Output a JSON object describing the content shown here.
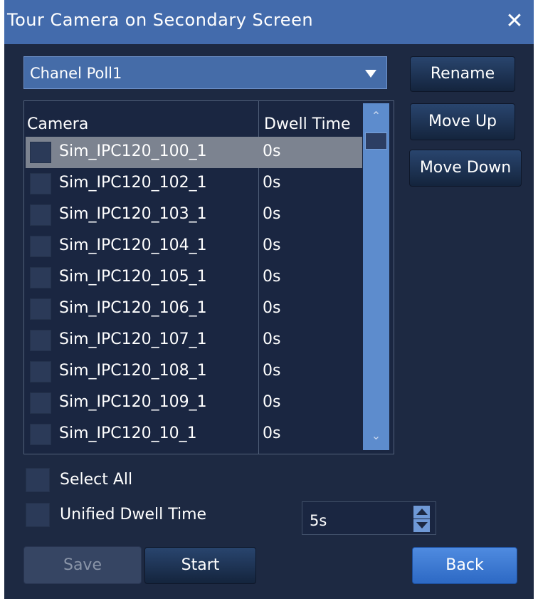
{
  "window": {
    "title": "Tour Camera on Secondary Screen",
    "close_glyph": "✕"
  },
  "poll_select": {
    "value": "Chanel Poll1"
  },
  "side_buttons": {
    "rename": "Rename",
    "move_up": "Move Up",
    "move_down": "Move Down"
  },
  "table": {
    "headers": [
      "Camera",
      "Dwell Time"
    ],
    "rows": [
      {
        "camera": "Sim_IPC120_100_1",
        "dwell": "0s",
        "selected": true
      },
      {
        "camera": "Sim_IPC120_102_1",
        "dwell": "0s",
        "selected": false
      },
      {
        "camera": "Sim_IPC120_103_1",
        "dwell": "0s",
        "selected": false
      },
      {
        "camera": "Sim_IPC120_104_1",
        "dwell": "0s",
        "selected": false
      },
      {
        "camera": "Sim_IPC120_105_1",
        "dwell": "0s",
        "selected": false
      },
      {
        "camera": "Sim_IPC120_106_1",
        "dwell": "0s",
        "selected": false
      },
      {
        "camera": "Sim_IPC120_107_1",
        "dwell": "0s",
        "selected": false
      },
      {
        "camera": "Sim_IPC120_108_1",
        "dwell": "0s",
        "selected": false
      },
      {
        "camera": "Sim_IPC120_109_1",
        "dwell": "0s",
        "selected": false
      },
      {
        "camera": "Sim_IPC120_10_1",
        "dwell": "0s",
        "selected": false
      }
    ]
  },
  "options": {
    "select_all_label": "Select All",
    "unified_dwell_label": "Unified Dwell Time",
    "unified_dwell_value": "5s"
  },
  "footer": {
    "save": "Save",
    "start": "Start",
    "back": "Back"
  },
  "colors": {
    "titlebar": "#436bac",
    "background": "#1d2942",
    "selected_row": "#7c8390",
    "back_button": "#3a7ad6"
  }
}
